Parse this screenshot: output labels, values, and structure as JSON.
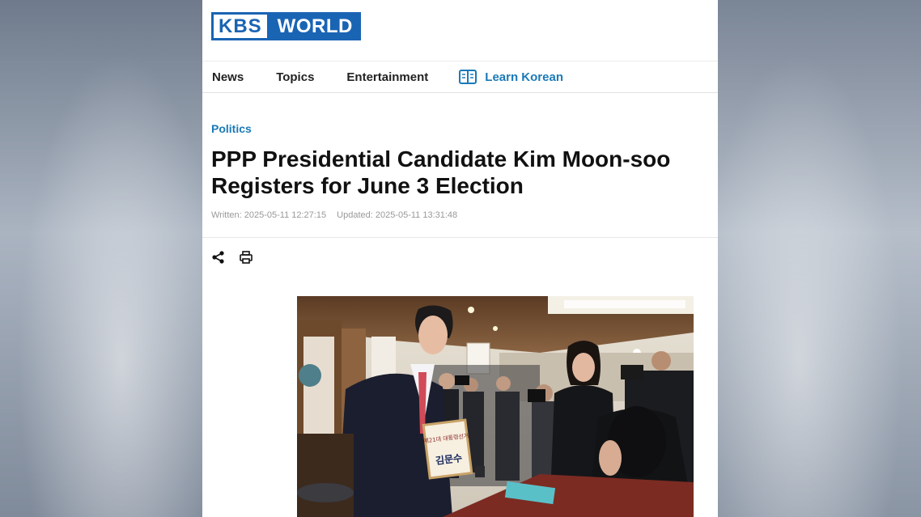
{
  "logo": {
    "kbs": "KBS",
    "world": "WORLD"
  },
  "nav": {
    "items": [
      "News",
      "Topics",
      "Entertainment"
    ],
    "learn_korean": "Learn Korean"
  },
  "article": {
    "category": "Politics",
    "headline": "PPP Presidential Candidate Kim Moon-soo Registers for June 3 Election",
    "written": "Written: 2025-05-11 12:27:15",
    "updated": "Updated: 2025-05-11 13:31:48"
  },
  "photo": {
    "sign_line1": "제21대 대통령선거",
    "sign_name": "김문수"
  },
  "colors": {
    "brand": "#1a64b4",
    "accent": "#1a7ab8"
  }
}
